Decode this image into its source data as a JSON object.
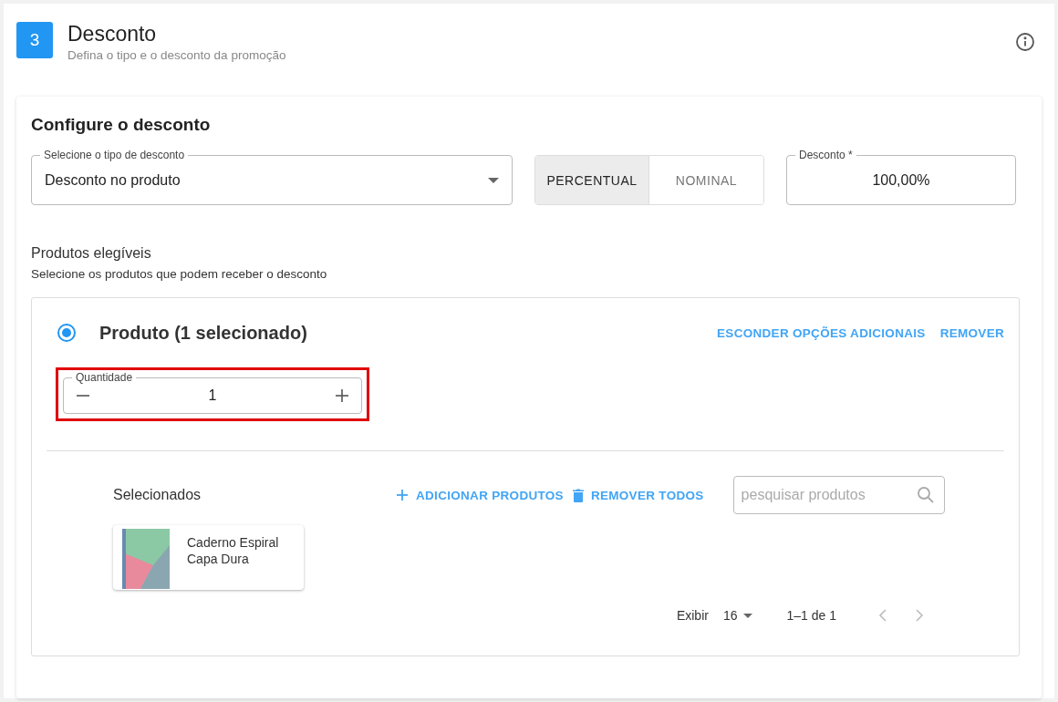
{
  "step": {
    "number": "3",
    "title": "Desconto",
    "subtitle": "Defina o tipo e o desconto da promoção"
  },
  "config": {
    "title": "Configure o desconto",
    "type_select": {
      "label": "Selecione o tipo de desconto",
      "value": "Desconto no produto"
    },
    "mode_toggle": [
      {
        "label": "PERCENTUAL",
        "selected": true
      },
      {
        "label": "NOMINAL",
        "selected": false
      }
    ],
    "discount_field": {
      "label": "Desconto *",
      "value": "100,00%"
    }
  },
  "eligible": {
    "title": "Produtos elegíveis",
    "subtitle": "Selecione os produtos que podem receber o desconto"
  },
  "product_option": {
    "selected": true,
    "label": "Produto (1 selecionado)",
    "links": [
      "ESCONDER OPÇÕES ADICIONAIS",
      "REMOVER"
    ],
    "quantity": {
      "label": "Quantidade",
      "value": "1",
      "highlighted": true
    }
  },
  "selected_list": {
    "title": "Selecionados",
    "add_button": "ADICIONAR PRODUTOS",
    "remove_all_button": "REMOVER TODOS",
    "search": {
      "placeholder": "pesquisar produtos"
    },
    "products": [
      {
        "name": "Caderno Espiral Capa Dura"
      }
    ],
    "pagination": {
      "show_label": "Exibir",
      "per_page": "16",
      "range": "1–1 de 1"
    }
  }
}
